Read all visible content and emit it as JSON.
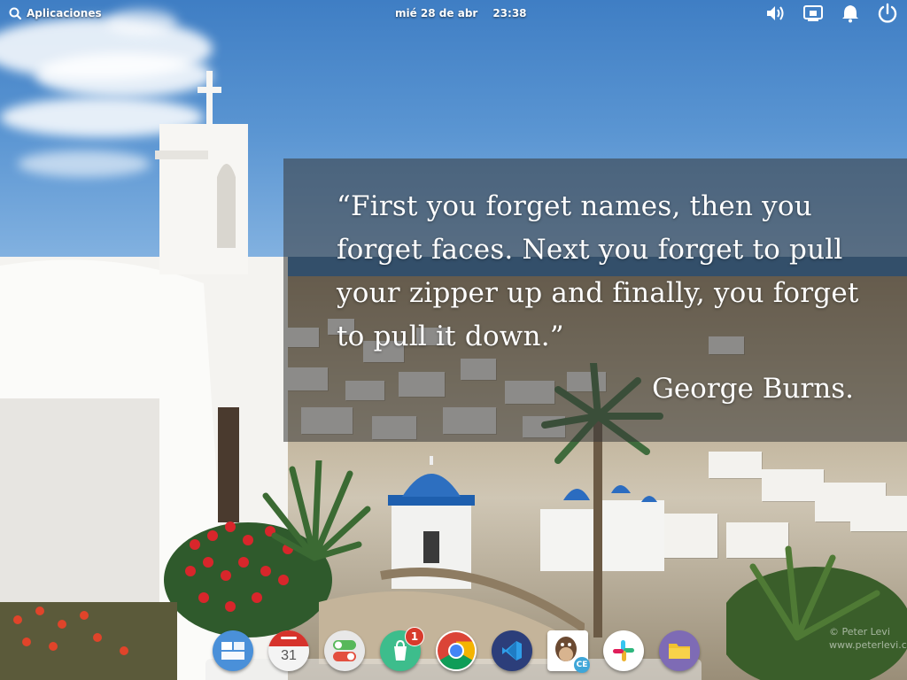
{
  "panel": {
    "applications_label": "Aplicaciones",
    "date": "mié 28 de abr",
    "time": "23:38",
    "indicators": [
      "volume-icon",
      "network-icon",
      "notifications-icon",
      "power-icon"
    ]
  },
  "quote": {
    "text": "“First you forget names, then you forget faces. Next you forget to pull your zipper up and finally, you forget to pull it down.”",
    "author": "George Burns."
  },
  "watermark": {
    "line1": "© Peter Levi",
    "line2": "www.peterlevi.c"
  },
  "dock": {
    "apps": [
      {
        "name": "multitasking-view-icon",
        "color": "#4a90d9"
      },
      {
        "name": "calendar-icon",
        "label": "31",
        "color": "#f4f4f4"
      },
      {
        "name": "settings-toggle-icon",
        "color": "#e8e8e8"
      },
      {
        "name": "appcenter-icon",
        "color": "#3dbd8c",
        "badge": "1"
      },
      {
        "name": "chrome-icon",
        "color": "#ffffff"
      },
      {
        "name": "vscode-icon",
        "color": "#2c3e7a"
      },
      {
        "name": "dbeaver-icon",
        "label": "CE",
        "color": "#ffffff"
      },
      {
        "name": "slack-icon",
        "color": "#ffffff"
      },
      {
        "name": "files-icon",
        "color": "#7e6bb5"
      }
    ]
  }
}
